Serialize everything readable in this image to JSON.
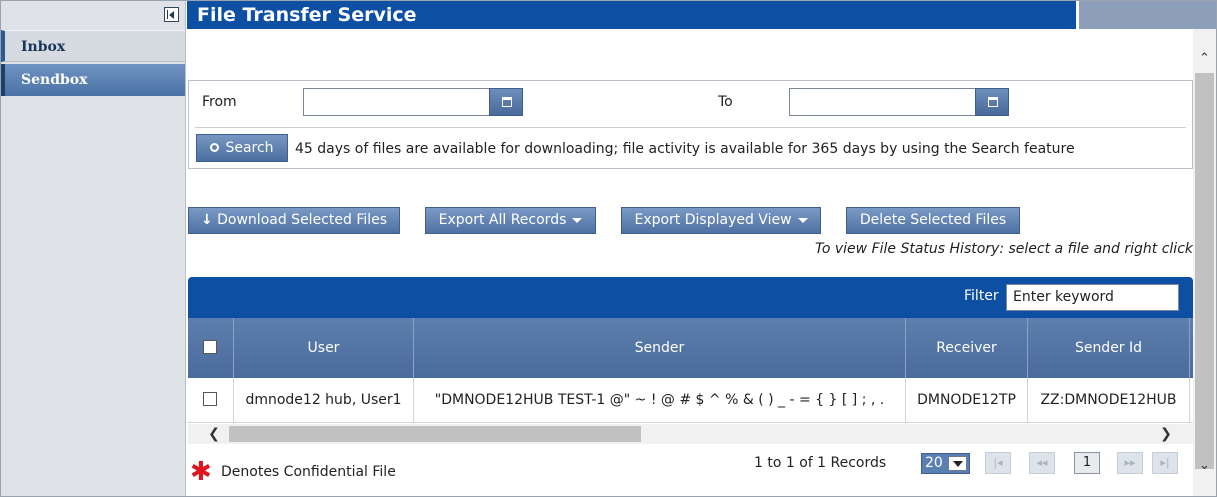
{
  "sidebar": {
    "collapse_icon": "collapse-left-icon",
    "items": [
      {
        "label": "Inbox"
      },
      {
        "label": "Sendbox"
      }
    ]
  },
  "header": {
    "title": "File Transfer Service"
  },
  "search": {
    "from_label": "From",
    "to_label": "To",
    "from_value": "",
    "to_value": "",
    "calendar_icon": "calendar-icon",
    "search_button": "Search",
    "search_icon": "search-icon",
    "note": "45 days of files are available for downloading; file activity is available for 365 days by using the Search feature"
  },
  "actions": {
    "download": "Download Selected Files",
    "download_icon": "down-arrow-icon",
    "export_all": "Export All Records",
    "export_view": "Export Displayed View",
    "delete": "Delete Selected Files",
    "hint": "To view File Status History: select a file and right click"
  },
  "grid": {
    "filter_label": "Filter",
    "filter_placeholder": "Enter keyword",
    "columns": [
      "User",
      "Sender",
      "Receiver",
      "Sender Id"
    ],
    "rows": [
      {
        "user": "dmnode12 hub, User1",
        "sender": "\"DMNODE12HUB TEST-1 @\" ~ ! @ # $ ^ % & ( ) _ - = { } [ ] ; , .",
        "receiver": "DMNODE12TP",
        "sender_id": "ZZ:DMNODE12HUB"
      }
    ]
  },
  "footer": {
    "confidential_mark": "✱",
    "confidential_label": "Denotes Confidential File",
    "records": "1 to 1 of 1 Records",
    "page_size": "20",
    "current_page": "1",
    "pager_icons": [
      "first-page-icon",
      "prev-page-icon",
      "next-page-icon",
      "last-page-icon"
    ],
    "pager_glyphs": {
      "first": "|◂",
      "prev": "◂◂",
      "next": "▸▸",
      "last": "▸|"
    }
  },
  "colors": {
    "header_blue": "#0c4fa3",
    "button_blue": "#5a7cad",
    "confidential_red": "#e0141e"
  }
}
